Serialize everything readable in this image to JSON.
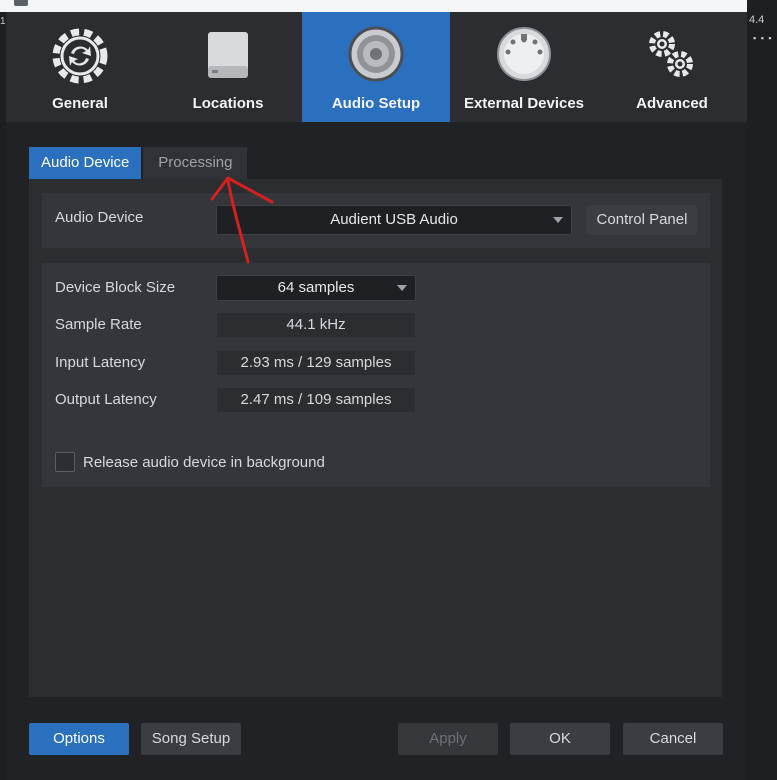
{
  "edge": {
    "left_text": "1",
    "right_text": "4.4",
    "right_dots": "▪ ▪ ▪"
  },
  "toolbar": {
    "items": [
      {
        "label": "General",
        "icon": "sync-gear-icon"
      },
      {
        "label": "Locations",
        "icon": "hard-drive-icon"
      },
      {
        "label": "Audio Setup",
        "icon": "speaker-icon"
      },
      {
        "label": "External Devices",
        "icon": "midi-port-icon"
      },
      {
        "label": "Advanced",
        "icon": "gears-icon"
      }
    ],
    "active": "Audio Setup"
  },
  "tabs": {
    "audio_device": "Audio Device",
    "processing": "Processing"
  },
  "device": {
    "label": "Audio Device",
    "value": "Audient USB Audio",
    "control_panel": "Control Panel"
  },
  "settings": {
    "block_size_label": "Device Block Size",
    "block_size_value": "64 samples",
    "sample_rate_label": "Sample Rate",
    "sample_rate_value": "44.1 kHz",
    "input_latency_label": "Input Latency",
    "input_latency_value": "2.93 ms / 129 samples",
    "output_latency_label": "Output Latency",
    "output_latency_value": "2.47 ms / 109 samples",
    "release_label": "Release audio device in background",
    "release_checked": false
  },
  "footer": {
    "options": "Options",
    "song_setup": "Song Setup",
    "apply": "Apply",
    "ok": "OK",
    "cancel": "Cancel"
  },
  "colors": {
    "accent": "#2b6fbf",
    "annotation": "#d61f1f"
  }
}
